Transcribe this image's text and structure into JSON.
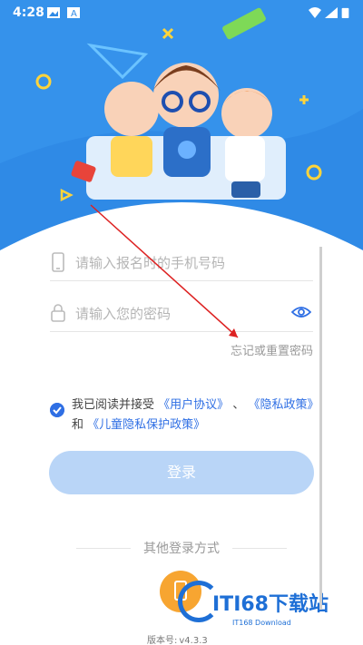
{
  "status_bar": {
    "time": "4:28"
  },
  "form": {
    "phone_placeholder": "请输入报名时的手机号码",
    "password_placeholder": "请输入您的密码",
    "forgot_password": "忘记或重置密码"
  },
  "agreement": {
    "prefix": "我已阅读并接受",
    "user_agreement": "《用户协议》",
    "separator": "、",
    "privacy_policy": "《隐私政策》",
    "and": "和",
    "child_privacy": "《儿童隐私保护政策》"
  },
  "login_button": "登录",
  "other_login": "其他登录方式",
  "version": {
    "label": "版本号:",
    "value": "v4.3.3"
  },
  "watermark": {
    "text": "ITI68下载站",
    "sub": "IT168 Download"
  },
  "colors": {
    "sky": "#2f8ae6",
    "accent": "#2f6fe4",
    "button": "#b9d5f7",
    "alt_login": "#f7a531"
  },
  "icons": [
    "phone-icon",
    "lock-icon",
    "eye-icon",
    "check-icon"
  ]
}
